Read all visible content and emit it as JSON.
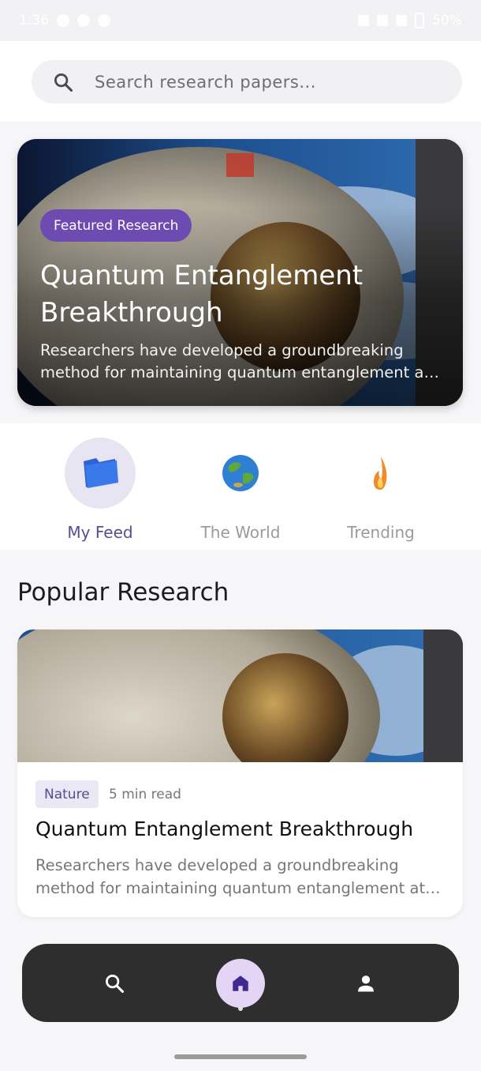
{
  "status_bar": {
    "time": "1:36",
    "battery": "50%"
  },
  "search": {
    "placeholder": "Search research papers..."
  },
  "featured": {
    "badge": "Featured Research",
    "title": "Quantum Entanglement Breakthrough",
    "description": "Researchers have developed a groundbreaking method for maintaining quantum entanglement at room temperature"
  },
  "categories": [
    {
      "label": "My Feed",
      "icon": "folder-icon",
      "active": true
    },
    {
      "label": "The World",
      "icon": "globe-icon",
      "active": false
    },
    {
      "label": "Trending",
      "icon": "fire-icon",
      "active": false
    }
  ],
  "popular": {
    "section_title": "Popular Research",
    "cards": [
      {
        "tag": "Nature",
        "read_time": "5 min read",
        "title": "Quantum Entanglement Breakthrough",
        "description": "Researchers have developed a groundbreaking method for maintaining quantum entanglement at room temperature"
      }
    ]
  },
  "bottom_nav": [
    {
      "icon": "search-icon",
      "active": false
    },
    {
      "icon": "home-icon",
      "active": true
    },
    {
      "icon": "profile-icon",
      "active": false
    }
  ],
  "colors": {
    "accent": "#6e4bb1",
    "accent_light": "#e8e5f3",
    "nav_bg": "#2e2e2e"
  }
}
